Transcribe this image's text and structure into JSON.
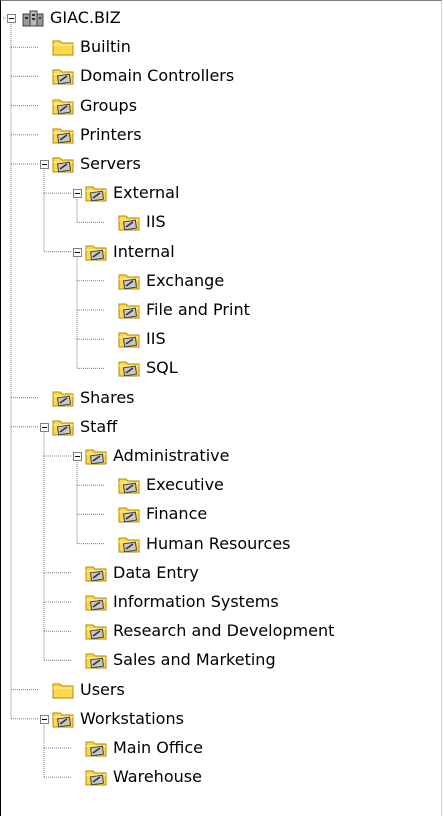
{
  "tree": {
    "root": {
      "label": "GIAC.BIZ",
      "icon": "domain-icon",
      "expanded": true
    },
    "items": [
      {
        "label": "Builtin",
        "icon": "folder-icon",
        "depth": 1
      },
      {
        "label": "Domain Controllers",
        "icon": "ou-icon",
        "depth": 1
      },
      {
        "label": "Groups",
        "icon": "ou-icon",
        "depth": 1
      },
      {
        "label": "Printers",
        "icon": "ou-icon",
        "depth": 1
      },
      {
        "label": "Servers",
        "icon": "ou-icon",
        "depth": 1,
        "expanded": true
      },
      {
        "label": "External",
        "icon": "ou-icon",
        "depth": 2,
        "expanded": true
      },
      {
        "label": "IIS",
        "icon": "ou-icon",
        "depth": 3
      },
      {
        "label": "Internal",
        "icon": "ou-icon",
        "depth": 2,
        "expanded": true
      },
      {
        "label": "Exchange",
        "icon": "ou-icon",
        "depth": 3
      },
      {
        "label": "File and Print",
        "icon": "ou-icon",
        "depth": 3
      },
      {
        "label": "IIS",
        "icon": "ou-icon",
        "depth": 3
      },
      {
        "label": "SQL",
        "icon": "ou-icon",
        "depth": 3
      },
      {
        "label": "Shares",
        "icon": "ou-icon",
        "depth": 1
      },
      {
        "label": "Staff",
        "icon": "ou-icon",
        "depth": 1,
        "expanded": true
      },
      {
        "label": "Administrative",
        "icon": "ou-icon",
        "depth": 2,
        "expanded": true
      },
      {
        "label": "Executive",
        "icon": "ou-icon",
        "depth": 3
      },
      {
        "label": "Finance",
        "icon": "ou-icon",
        "depth": 3
      },
      {
        "label": "Human Resources",
        "icon": "ou-icon",
        "depth": 3
      },
      {
        "label": "Data Entry",
        "icon": "ou-icon",
        "depth": 2
      },
      {
        "label": "Information Systems",
        "icon": "ou-icon",
        "depth": 2
      },
      {
        "label": "Research and Development",
        "icon": "ou-icon",
        "depth": 2
      },
      {
        "label": "Sales and Marketing",
        "icon": "ou-icon",
        "depth": 2
      },
      {
        "label": "Users",
        "icon": "folder-icon",
        "depth": 1
      },
      {
        "label": "Workstations",
        "icon": "ou-icon",
        "depth": 1,
        "expanded": true
      },
      {
        "label": "Main Office",
        "icon": "ou-icon",
        "depth": 2
      },
      {
        "label": "Warehouse",
        "icon": "ou-icon",
        "depth": 2
      }
    ]
  },
  "colors": {
    "folder": "#ffd84a",
    "folder_edge": "#b08a00",
    "tree_line": "#808080",
    "book": "#c8c8c8"
  }
}
